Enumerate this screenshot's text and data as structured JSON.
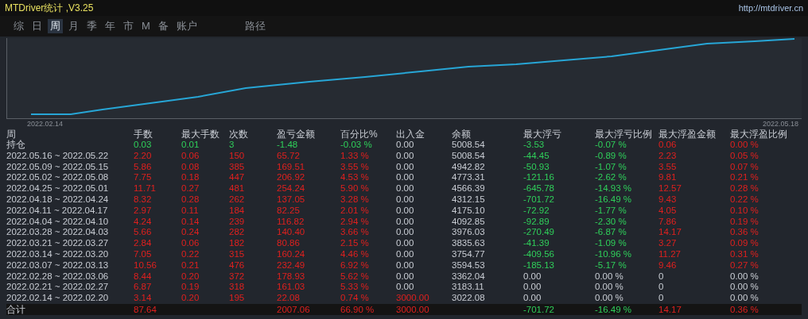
{
  "window": {
    "title": "MTDriver统计 ,V3.25",
    "link": "http://mtdriver.cn"
  },
  "tabs": [
    {
      "label": "综",
      "selected": false
    },
    {
      "label": "日",
      "selected": false
    },
    {
      "label": "周",
      "selected": true
    },
    {
      "label": "月",
      "selected": false
    },
    {
      "label": "季",
      "selected": false
    },
    {
      "label": "年",
      "selected": false
    },
    {
      "label": "市",
      "selected": false
    },
    {
      "label": "M",
      "selected": false
    },
    {
      "label": "备",
      "selected": false
    },
    {
      "label": "账户",
      "selected": false
    },
    {
      "label": "路径",
      "selected": false
    }
  ],
  "chart": {
    "start_label": "2022.02.14",
    "end_label": "2022.05.18"
  },
  "table": {
    "columns": [
      "周",
      "手数",
      "最大手数",
      "次数",
      "盈亏金额",
      "百分比%",
      "出入金",
      "余额",
      "最大浮亏",
      "最大浮亏比例",
      "最大浮盈金额",
      "最大浮盈比例"
    ],
    "rows": [
      {
        "cells": [
          {
            "text": "持仓",
            "kind": "plain"
          },
          {
            "text": "0.03",
            "kind": "loss"
          },
          {
            "text": "0.01",
            "kind": "loss"
          },
          {
            "text": "3",
            "kind": "loss"
          },
          {
            "text": "-1.48",
            "kind": "loss"
          },
          {
            "text": "-0.03 %",
            "kind": "loss"
          },
          {
            "text": "0.00",
            "kind": "plain"
          },
          {
            "text": "5008.54",
            "kind": "plain"
          },
          {
            "text": "-3.53",
            "kind": "loss"
          },
          {
            "text": "-0.07 %",
            "kind": "loss"
          },
          {
            "text": "0.06",
            "kind": "gain"
          },
          {
            "text": "0.00 %",
            "kind": "gain"
          }
        ]
      },
      {
        "cells": [
          {
            "text": "2022.05.16 ~ 2022.05.22",
            "kind": "plain"
          },
          {
            "text": "2.20",
            "kind": "gain"
          },
          {
            "text": "0.06",
            "kind": "gain"
          },
          {
            "text": "150",
            "kind": "gain"
          },
          {
            "text": "65.72",
            "kind": "gain"
          },
          {
            "text": "1.33 %",
            "kind": "gain"
          },
          {
            "text": "0.00",
            "kind": "plain"
          },
          {
            "text": "5008.54",
            "kind": "plain"
          },
          {
            "text": "-44.45",
            "kind": "loss"
          },
          {
            "text": "-0.89 %",
            "kind": "loss"
          },
          {
            "text": "2.23",
            "kind": "gain"
          },
          {
            "text": "0.05 %",
            "kind": "gain"
          }
        ]
      },
      {
        "cells": [
          {
            "text": "2022.05.09 ~ 2022.05.15",
            "kind": "plain"
          },
          {
            "text": "5.86",
            "kind": "gain"
          },
          {
            "text": "0.08",
            "kind": "gain"
          },
          {
            "text": "385",
            "kind": "gain"
          },
          {
            "text": "169.51",
            "kind": "gain"
          },
          {
            "text": "3.55 %",
            "kind": "gain"
          },
          {
            "text": "0.00",
            "kind": "plain"
          },
          {
            "text": "4942.82",
            "kind": "plain"
          },
          {
            "text": "-50.93",
            "kind": "loss"
          },
          {
            "text": "-1.07 %",
            "kind": "loss"
          },
          {
            "text": "3.55",
            "kind": "gain"
          },
          {
            "text": "0.07 %",
            "kind": "gain"
          }
        ]
      },
      {
        "cells": [
          {
            "text": "2022.05.02 ~ 2022.05.08",
            "kind": "plain"
          },
          {
            "text": "7.75",
            "kind": "gain"
          },
          {
            "text": "0.18",
            "kind": "gain"
          },
          {
            "text": "447",
            "kind": "gain"
          },
          {
            "text": "206.92",
            "kind": "gain"
          },
          {
            "text": "4.53 %",
            "kind": "gain"
          },
          {
            "text": "0.00",
            "kind": "plain"
          },
          {
            "text": "4773.31",
            "kind": "plain"
          },
          {
            "text": "-121.16",
            "kind": "loss"
          },
          {
            "text": "-2.62 %",
            "kind": "loss"
          },
          {
            "text": "9.81",
            "kind": "gain"
          },
          {
            "text": "0.21 %",
            "kind": "gain"
          }
        ]
      },
      {
        "cells": [
          {
            "text": "2022.04.25 ~ 2022.05.01",
            "kind": "plain"
          },
          {
            "text": "11.71",
            "kind": "gain"
          },
          {
            "text": "0.27",
            "kind": "gain"
          },
          {
            "text": "481",
            "kind": "gain"
          },
          {
            "text": "254.24",
            "kind": "gain"
          },
          {
            "text": "5.90 %",
            "kind": "gain"
          },
          {
            "text": "0.00",
            "kind": "plain"
          },
          {
            "text": "4566.39",
            "kind": "plain"
          },
          {
            "text": "-645.78",
            "kind": "loss"
          },
          {
            "text": "-14.93 %",
            "kind": "loss"
          },
          {
            "text": "12.57",
            "kind": "gain"
          },
          {
            "text": "0.28 %",
            "kind": "gain"
          }
        ]
      },
      {
        "cells": [
          {
            "text": "2022.04.18 ~ 2022.04.24",
            "kind": "plain"
          },
          {
            "text": "8.32",
            "kind": "gain"
          },
          {
            "text": "0.28",
            "kind": "gain"
          },
          {
            "text": "262",
            "kind": "gain"
          },
          {
            "text": "137.05",
            "kind": "gain"
          },
          {
            "text": "3.28 %",
            "kind": "gain"
          },
          {
            "text": "0.00",
            "kind": "plain"
          },
          {
            "text": "4312.15",
            "kind": "plain"
          },
          {
            "text": "-701.72",
            "kind": "loss"
          },
          {
            "text": "-16.49 %",
            "kind": "loss"
          },
          {
            "text": "9.43",
            "kind": "gain"
          },
          {
            "text": "0.22 %",
            "kind": "gain"
          }
        ]
      },
      {
        "cells": [
          {
            "text": "2022.04.11 ~ 2022.04.17",
            "kind": "plain"
          },
          {
            "text": "2.97",
            "kind": "gain"
          },
          {
            "text": "0.11",
            "kind": "gain"
          },
          {
            "text": "184",
            "kind": "gain"
          },
          {
            "text": "82.25",
            "kind": "gain"
          },
          {
            "text": "2.01 %",
            "kind": "gain"
          },
          {
            "text": "0.00",
            "kind": "plain"
          },
          {
            "text": "4175.10",
            "kind": "plain"
          },
          {
            "text": "-72.92",
            "kind": "loss"
          },
          {
            "text": "-1.77 %",
            "kind": "loss"
          },
          {
            "text": "4.05",
            "kind": "gain"
          },
          {
            "text": "0.10 %",
            "kind": "gain"
          }
        ]
      },
      {
        "cells": [
          {
            "text": "2022.04.04 ~ 2022.04.10",
            "kind": "plain"
          },
          {
            "text": "4.24",
            "kind": "gain"
          },
          {
            "text": "0.14",
            "kind": "gain"
          },
          {
            "text": "239",
            "kind": "gain"
          },
          {
            "text": "116.82",
            "kind": "gain"
          },
          {
            "text": "2.94 %",
            "kind": "gain"
          },
          {
            "text": "0.00",
            "kind": "plain"
          },
          {
            "text": "4092.85",
            "kind": "plain"
          },
          {
            "text": "-92.89",
            "kind": "loss"
          },
          {
            "text": "-2.30 %",
            "kind": "loss"
          },
          {
            "text": "7.86",
            "kind": "gain"
          },
          {
            "text": "0.19 %",
            "kind": "gain"
          }
        ]
      },
      {
        "cells": [
          {
            "text": "2022.03.28 ~ 2022.04.03",
            "kind": "plain"
          },
          {
            "text": "5.66",
            "kind": "gain"
          },
          {
            "text": "0.24",
            "kind": "gain"
          },
          {
            "text": "282",
            "kind": "gain"
          },
          {
            "text": "140.40",
            "kind": "gain"
          },
          {
            "text": "3.66 %",
            "kind": "gain"
          },
          {
            "text": "0.00",
            "kind": "plain"
          },
          {
            "text": "3976.03",
            "kind": "plain"
          },
          {
            "text": "-270.49",
            "kind": "loss"
          },
          {
            "text": "-6.87 %",
            "kind": "loss"
          },
          {
            "text": "14.17",
            "kind": "gain"
          },
          {
            "text": "0.36 %",
            "kind": "gain"
          }
        ]
      },
      {
        "cells": [
          {
            "text": "2022.03.21 ~ 2022.03.27",
            "kind": "plain"
          },
          {
            "text": "2.84",
            "kind": "gain"
          },
          {
            "text": "0.06",
            "kind": "gain"
          },
          {
            "text": "182",
            "kind": "gain"
          },
          {
            "text": "80.86",
            "kind": "gain"
          },
          {
            "text": "2.15 %",
            "kind": "gain"
          },
          {
            "text": "0.00",
            "kind": "plain"
          },
          {
            "text": "3835.63",
            "kind": "plain"
          },
          {
            "text": "-41.39",
            "kind": "loss"
          },
          {
            "text": "-1.09 %",
            "kind": "loss"
          },
          {
            "text": "3.27",
            "kind": "gain"
          },
          {
            "text": "0.09 %",
            "kind": "gain"
          }
        ]
      },
      {
        "cells": [
          {
            "text": "2022.03.14 ~ 2022.03.20",
            "kind": "plain"
          },
          {
            "text": "7.05",
            "kind": "gain"
          },
          {
            "text": "0.22",
            "kind": "gain"
          },
          {
            "text": "315",
            "kind": "gain"
          },
          {
            "text": "160.24",
            "kind": "gain"
          },
          {
            "text": "4.46 %",
            "kind": "gain"
          },
          {
            "text": "0.00",
            "kind": "plain"
          },
          {
            "text": "3754.77",
            "kind": "plain"
          },
          {
            "text": "-409.56",
            "kind": "loss"
          },
          {
            "text": "-10.96 %",
            "kind": "loss"
          },
          {
            "text": "11.27",
            "kind": "gain"
          },
          {
            "text": "0.31 %",
            "kind": "gain"
          }
        ]
      },
      {
        "cells": [
          {
            "text": "2022.03.07 ~ 2022.03.13",
            "kind": "plain"
          },
          {
            "text": "10.56",
            "kind": "gain"
          },
          {
            "text": "0.21",
            "kind": "gain"
          },
          {
            "text": "476",
            "kind": "gain"
          },
          {
            "text": "232.49",
            "kind": "gain"
          },
          {
            "text": "6.92 %",
            "kind": "gain"
          },
          {
            "text": "0.00",
            "kind": "plain"
          },
          {
            "text": "3594.53",
            "kind": "plain"
          },
          {
            "text": "-185.13",
            "kind": "loss"
          },
          {
            "text": "-5.17 %",
            "kind": "loss"
          },
          {
            "text": "9.46",
            "kind": "gain"
          },
          {
            "text": "0.27 %",
            "kind": "gain"
          }
        ]
      },
      {
        "cells": [
          {
            "text": "2022.02.28 ~ 2022.03.06",
            "kind": "plain"
          },
          {
            "text": "8.44",
            "kind": "gain"
          },
          {
            "text": "0.20",
            "kind": "gain"
          },
          {
            "text": "372",
            "kind": "gain"
          },
          {
            "text": "178.93",
            "kind": "gain"
          },
          {
            "text": "5.62 %",
            "kind": "gain"
          },
          {
            "text": "0.00",
            "kind": "plain"
          },
          {
            "text": "3362.04",
            "kind": "plain"
          },
          {
            "text": "0.00",
            "kind": "plain"
          },
          {
            "text": "0.00 %",
            "kind": "plain"
          },
          {
            "text": "0",
            "kind": "plain"
          },
          {
            "text": "0.00 %",
            "kind": "plain"
          }
        ]
      },
      {
        "cells": [
          {
            "text": "2022.02.21 ~ 2022.02.27",
            "kind": "plain"
          },
          {
            "text": "6.87",
            "kind": "gain"
          },
          {
            "text": "0.19",
            "kind": "gain"
          },
          {
            "text": "318",
            "kind": "gain"
          },
          {
            "text": "161.03",
            "kind": "gain"
          },
          {
            "text": "5.33 %",
            "kind": "gain"
          },
          {
            "text": "0.00",
            "kind": "plain"
          },
          {
            "text": "3183.11",
            "kind": "plain"
          },
          {
            "text": "0.00",
            "kind": "plain"
          },
          {
            "text": "0.00 %",
            "kind": "plain"
          },
          {
            "text": "0",
            "kind": "plain"
          },
          {
            "text": "0.00 %",
            "kind": "plain"
          }
        ]
      },
      {
        "cells": [
          {
            "text": "2022.02.14 ~ 2022.02.20",
            "kind": "plain"
          },
          {
            "text": "3.14",
            "kind": "gain"
          },
          {
            "text": "0.20",
            "kind": "gain"
          },
          {
            "text": "195",
            "kind": "gain"
          },
          {
            "text": "22.08",
            "kind": "gain"
          },
          {
            "text": "0.74 %",
            "kind": "gain"
          },
          {
            "text": "3000.00",
            "kind": "gain"
          },
          {
            "text": "3022.08",
            "kind": "plain"
          },
          {
            "text": "0.00",
            "kind": "plain"
          },
          {
            "text": "0.00 %",
            "kind": "plain"
          },
          {
            "text": "0",
            "kind": "plain"
          },
          {
            "text": "0.00 %",
            "kind": "plain"
          }
        ]
      }
    ],
    "total": {
      "cells": [
        {
          "text": "合计",
          "kind": "plain"
        },
        {
          "text": "87.64",
          "kind": "gain"
        },
        null,
        null,
        {
          "text": "2007.06",
          "kind": "gain"
        },
        {
          "text": "66.90 %",
          "kind": "gain"
        },
        {
          "text": "3000.00",
          "kind": "gain"
        },
        null,
        {
          "text": "-701.72",
          "kind": "loss"
        },
        {
          "text": "-16.49 %",
          "kind": "loss"
        },
        {
          "text": "14.17",
          "kind": "gain"
        },
        {
          "text": "0.36 %",
          "kind": "gain"
        }
      ]
    }
  }
}
